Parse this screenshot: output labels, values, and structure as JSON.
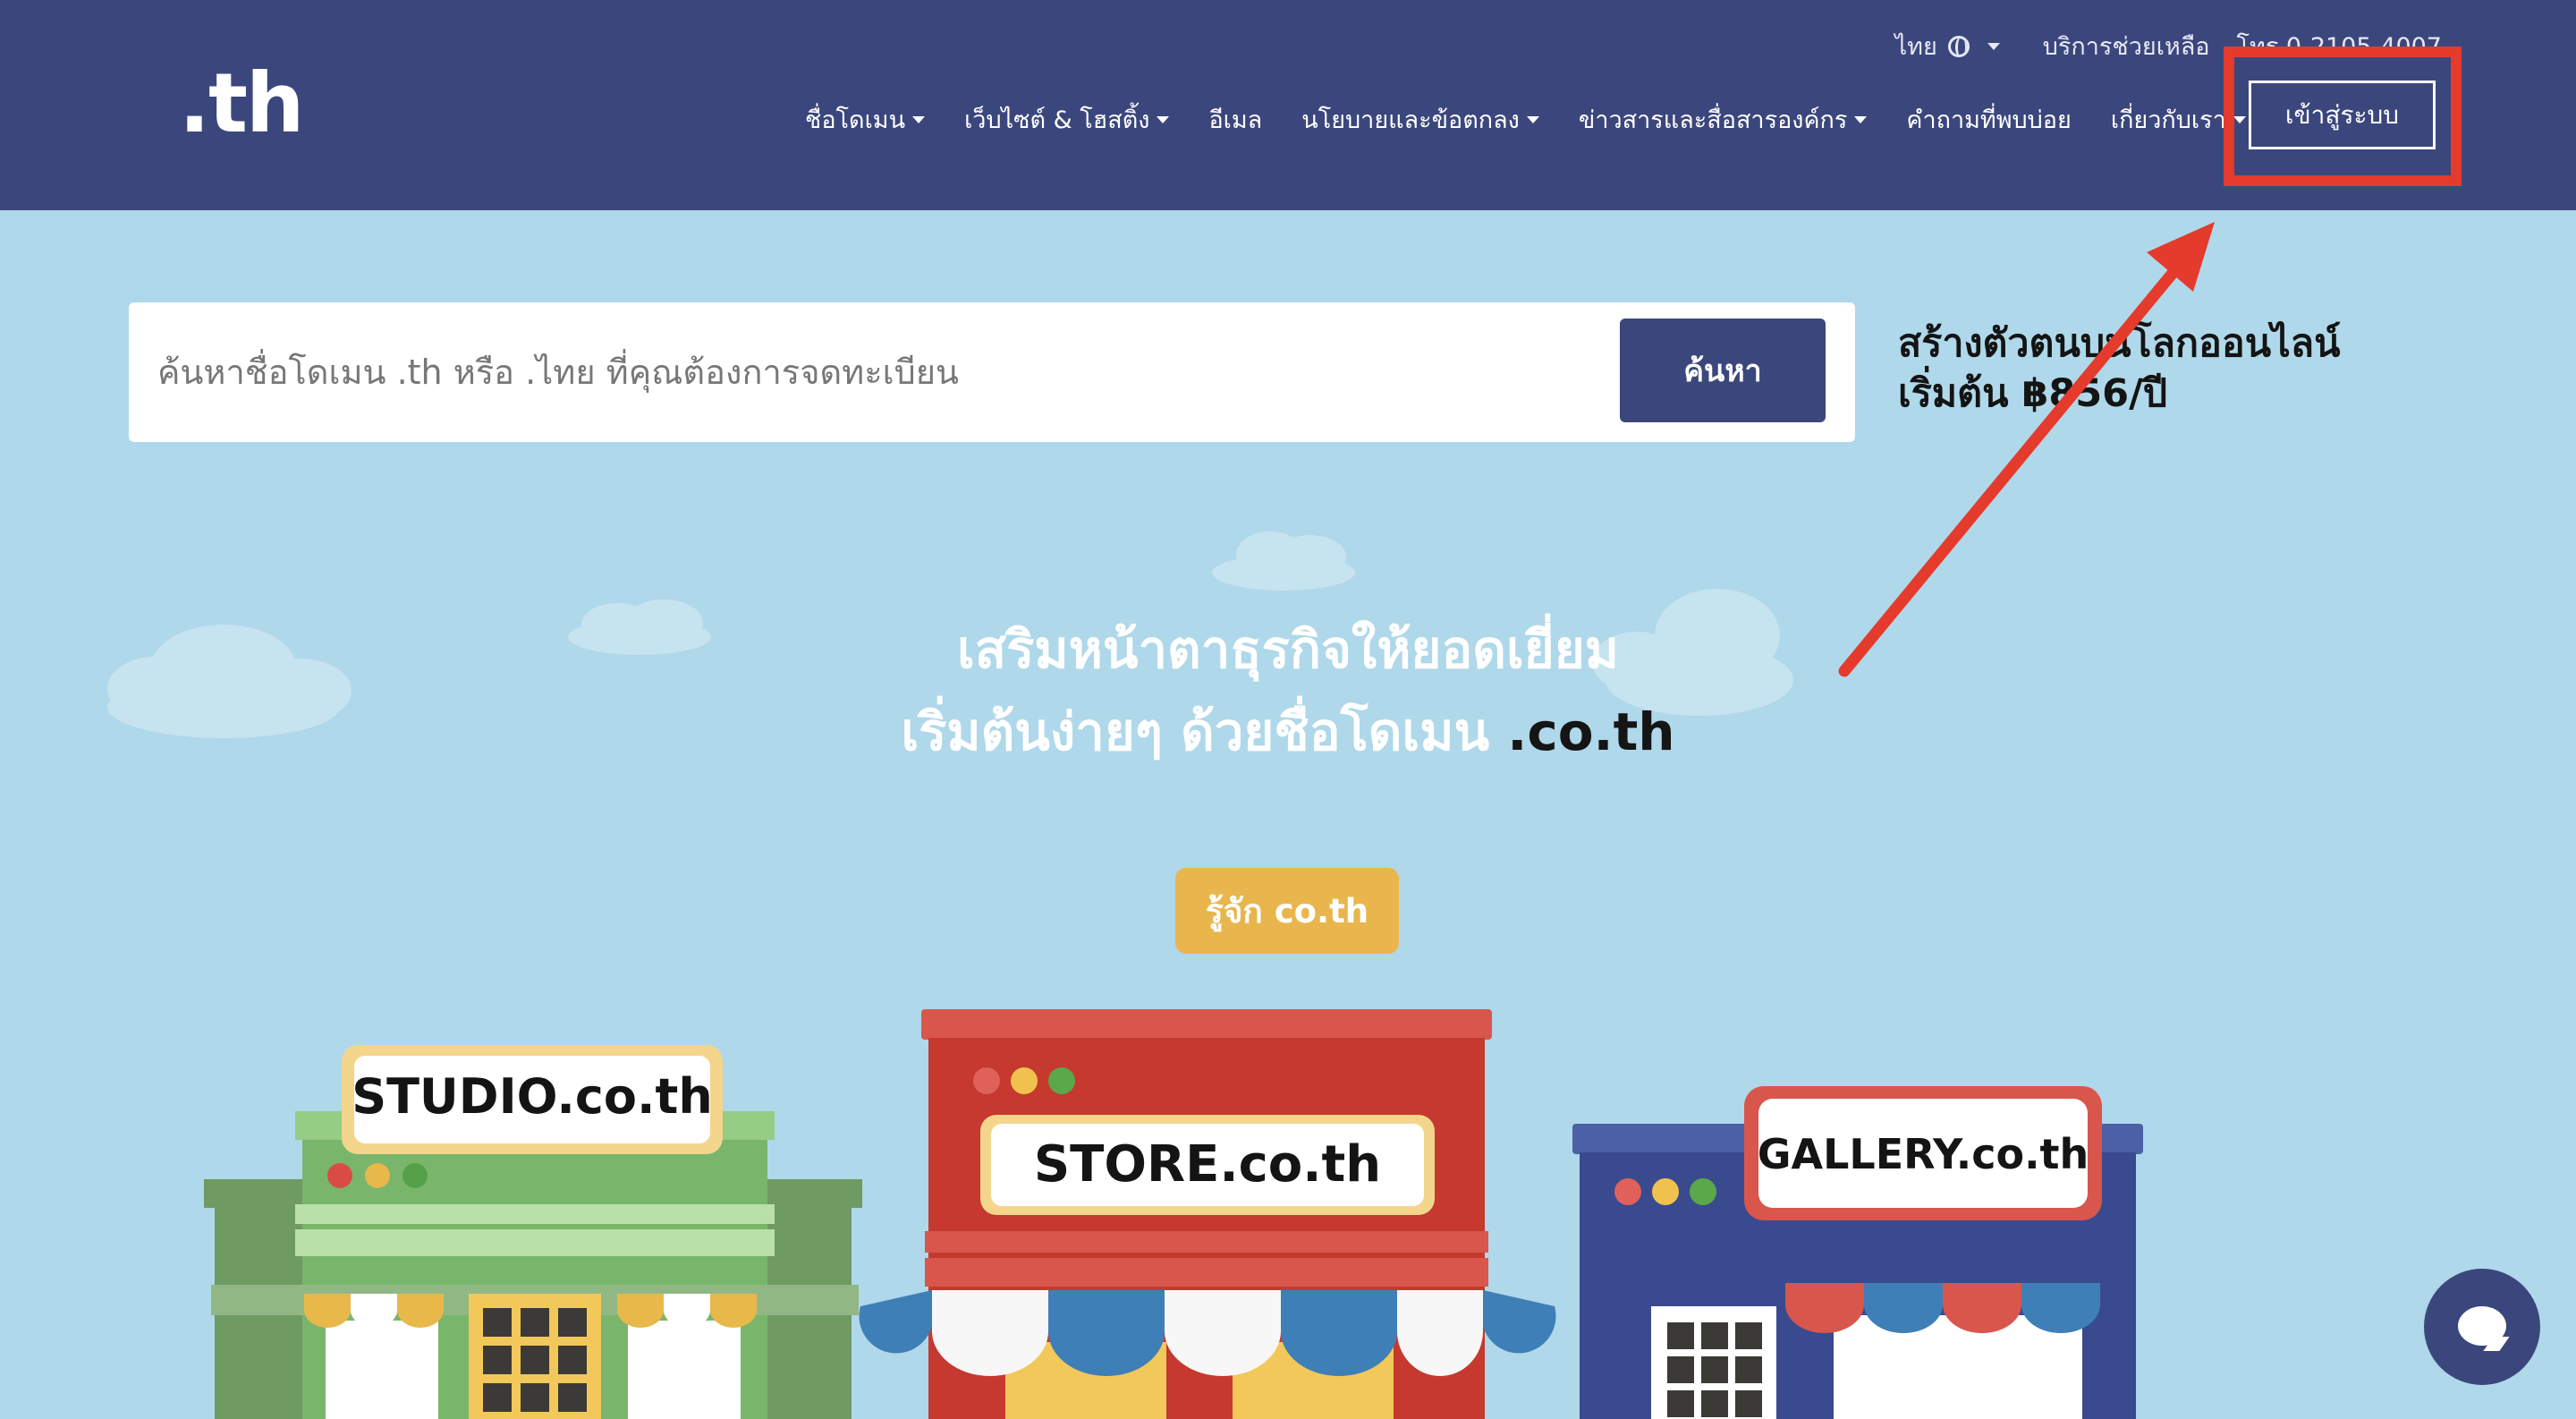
{
  "brand": {
    "logo_text": ".th"
  },
  "utility": {
    "language": "ไทย",
    "help": "บริการช่วยเหลือ",
    "phone": "โทร 0-2105-4007"
  },
  "nav": {
    "items": [
      {
        "label": "ชื่อโดเมน",
        "dropdown": true
      },
      {
        "label": "เว็บไซต์ & โฮสติ้ง",
        "dropdown": true
      },
      {
        "label": "อีเมล",
        "dropdown": false
      },
      {
        "label": "นโยบายและข้อตกลง",
        "dropdown": true
      },
      {
        "label": "ข่าวสารและสื่อสารองค์กร",
        "dropdown": true
      },
      {
        "label": "คำถามที่พบบ่อย",
        "dropdown": false
      },
      {
        "label": "เกี่ยวกับเรา",
        "dropdown": true
      }
    ],
    "login_label": "เข้าสู่ระบบ"
  },
  "search": {
    "placeholder": "ค้นหาชื่อโดเมน .th หรือ .ไทย ที่คุณต้องการจดทะเบียน",
    "value": "",
    "button_label": "ค้นหา"
  },
  "promo": {
    "line1": "สร้างตัวตนบนโลกออนไลน์",
    "line2": "เริ่มต้น ฿856/ปี"
  },
  "hero": {
    "line1": "เสริมหน้าตาธุรกิจให้ยอดเยี่ยม",
    "line2_prefix": "เริ่มต้นง่ายๆ ด้วยชื่อโดเมน ",
    "line2_highlight": ".co.th",
    "cta_label": "รู้จัก co.th"
  },
  "storefronts": {
    "studio_sign": "STUDIO.co.th",
    "store_sign": "STORE.co.th",
    "gallery_sign": "GALLERY.co.th"
  },
  "colors": {
    "header_bg": "#3b477c",
    "page_bg": "#afd8ea",
    "cta": "#e9b64d",
    "highlight": "#e53b2c"
  },
  "icons": {
    "globe": "globe-icon",
    "dropdown": "chevron-down-icon",
    "chat": "chat-icon"
  }
}
